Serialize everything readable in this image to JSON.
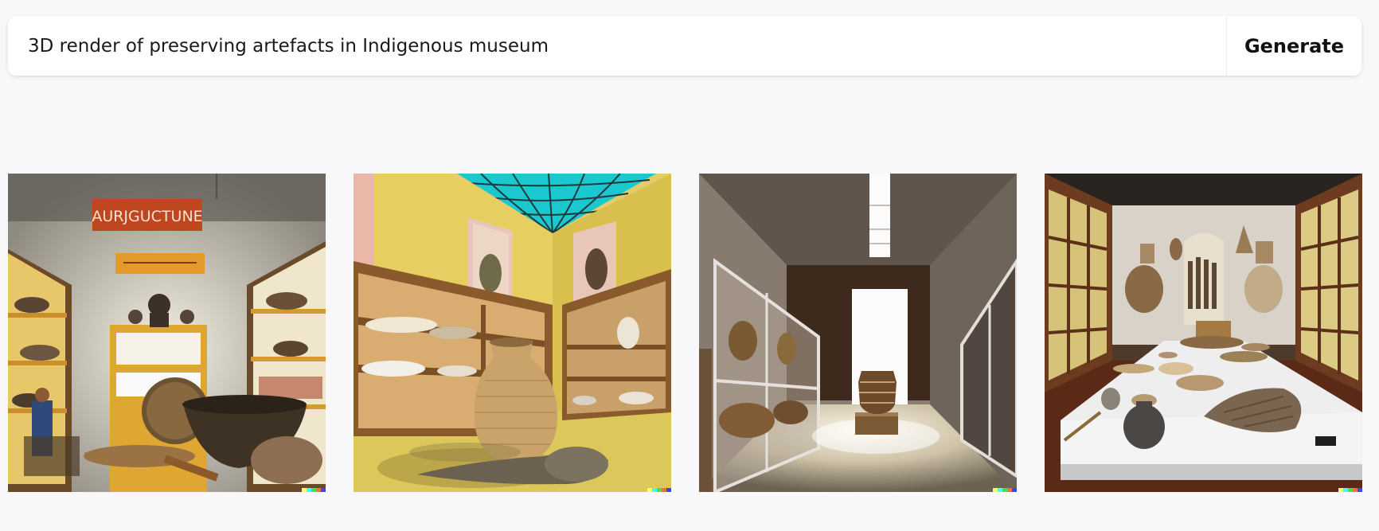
{
  "prompt": {
    "value": "3D render of preserving artefacts in Indigenous museum",
    "generate_label": "Generate"
  },
  "images": [
    {
      "name": "generated-image-1",
      "sign_text": "AURJGUCTUNE"
    },
    {
      "name": "generated-image-2"
    },
    {
      "name": "generated-image-3"
    },
    {
      "name": "generated-image-4"
    }
  ],
  "watermark_colors": [
    "#ffff66",
    "#42ffff",
    "#51da4c",
    "#ff6e3c",
    "#3c46ff"
  ]
}
